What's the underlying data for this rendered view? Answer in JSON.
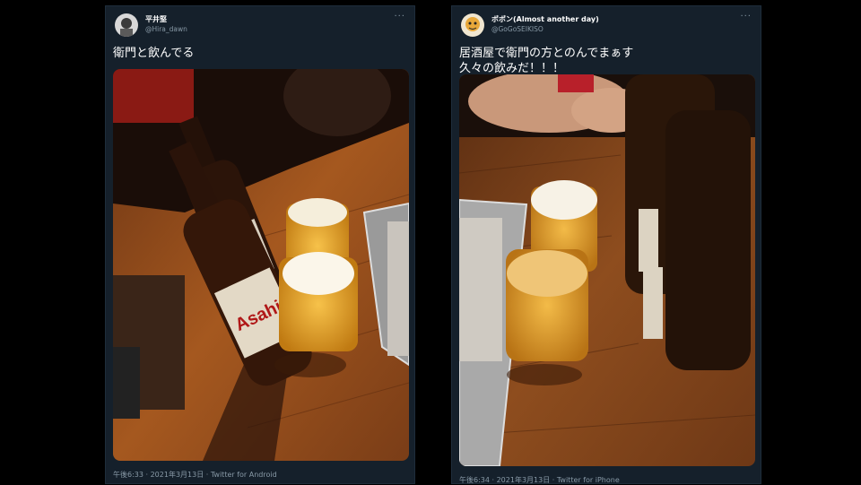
{
  "tweets": [
    {
      "name": "平井堅",
      "handle": "@Hira_dawn",
      "more": "···",
      "text": "衛門と飲んでる",
      "timestamp": "午後6:33 · 2021年3月13日 · Twitter for Android",
      "avatar_icon": "user-avatar",
      "photo_label": "Asahi"
    },
    {
      "name": "ポポン(Almost another day)",
      "handle": "@GoGoSEIKISO",
      "more": "···",
      "text_line1": "居酒屋で衛門の方とのんでまぁす",
      "text_line2": "久々の飲みだ！！！",
      "timestamp": "午後6:34 · 2021年3月13日 · Twitter for iPhone",
      "avatar_icon": "user-avatar"
    }
  ],
  "colors": {
    "background": "#000000",
    "card": "#15202b",
    "secondary_text": "#8899a6",
    "primary_text": "#ffffff"
  }
}
